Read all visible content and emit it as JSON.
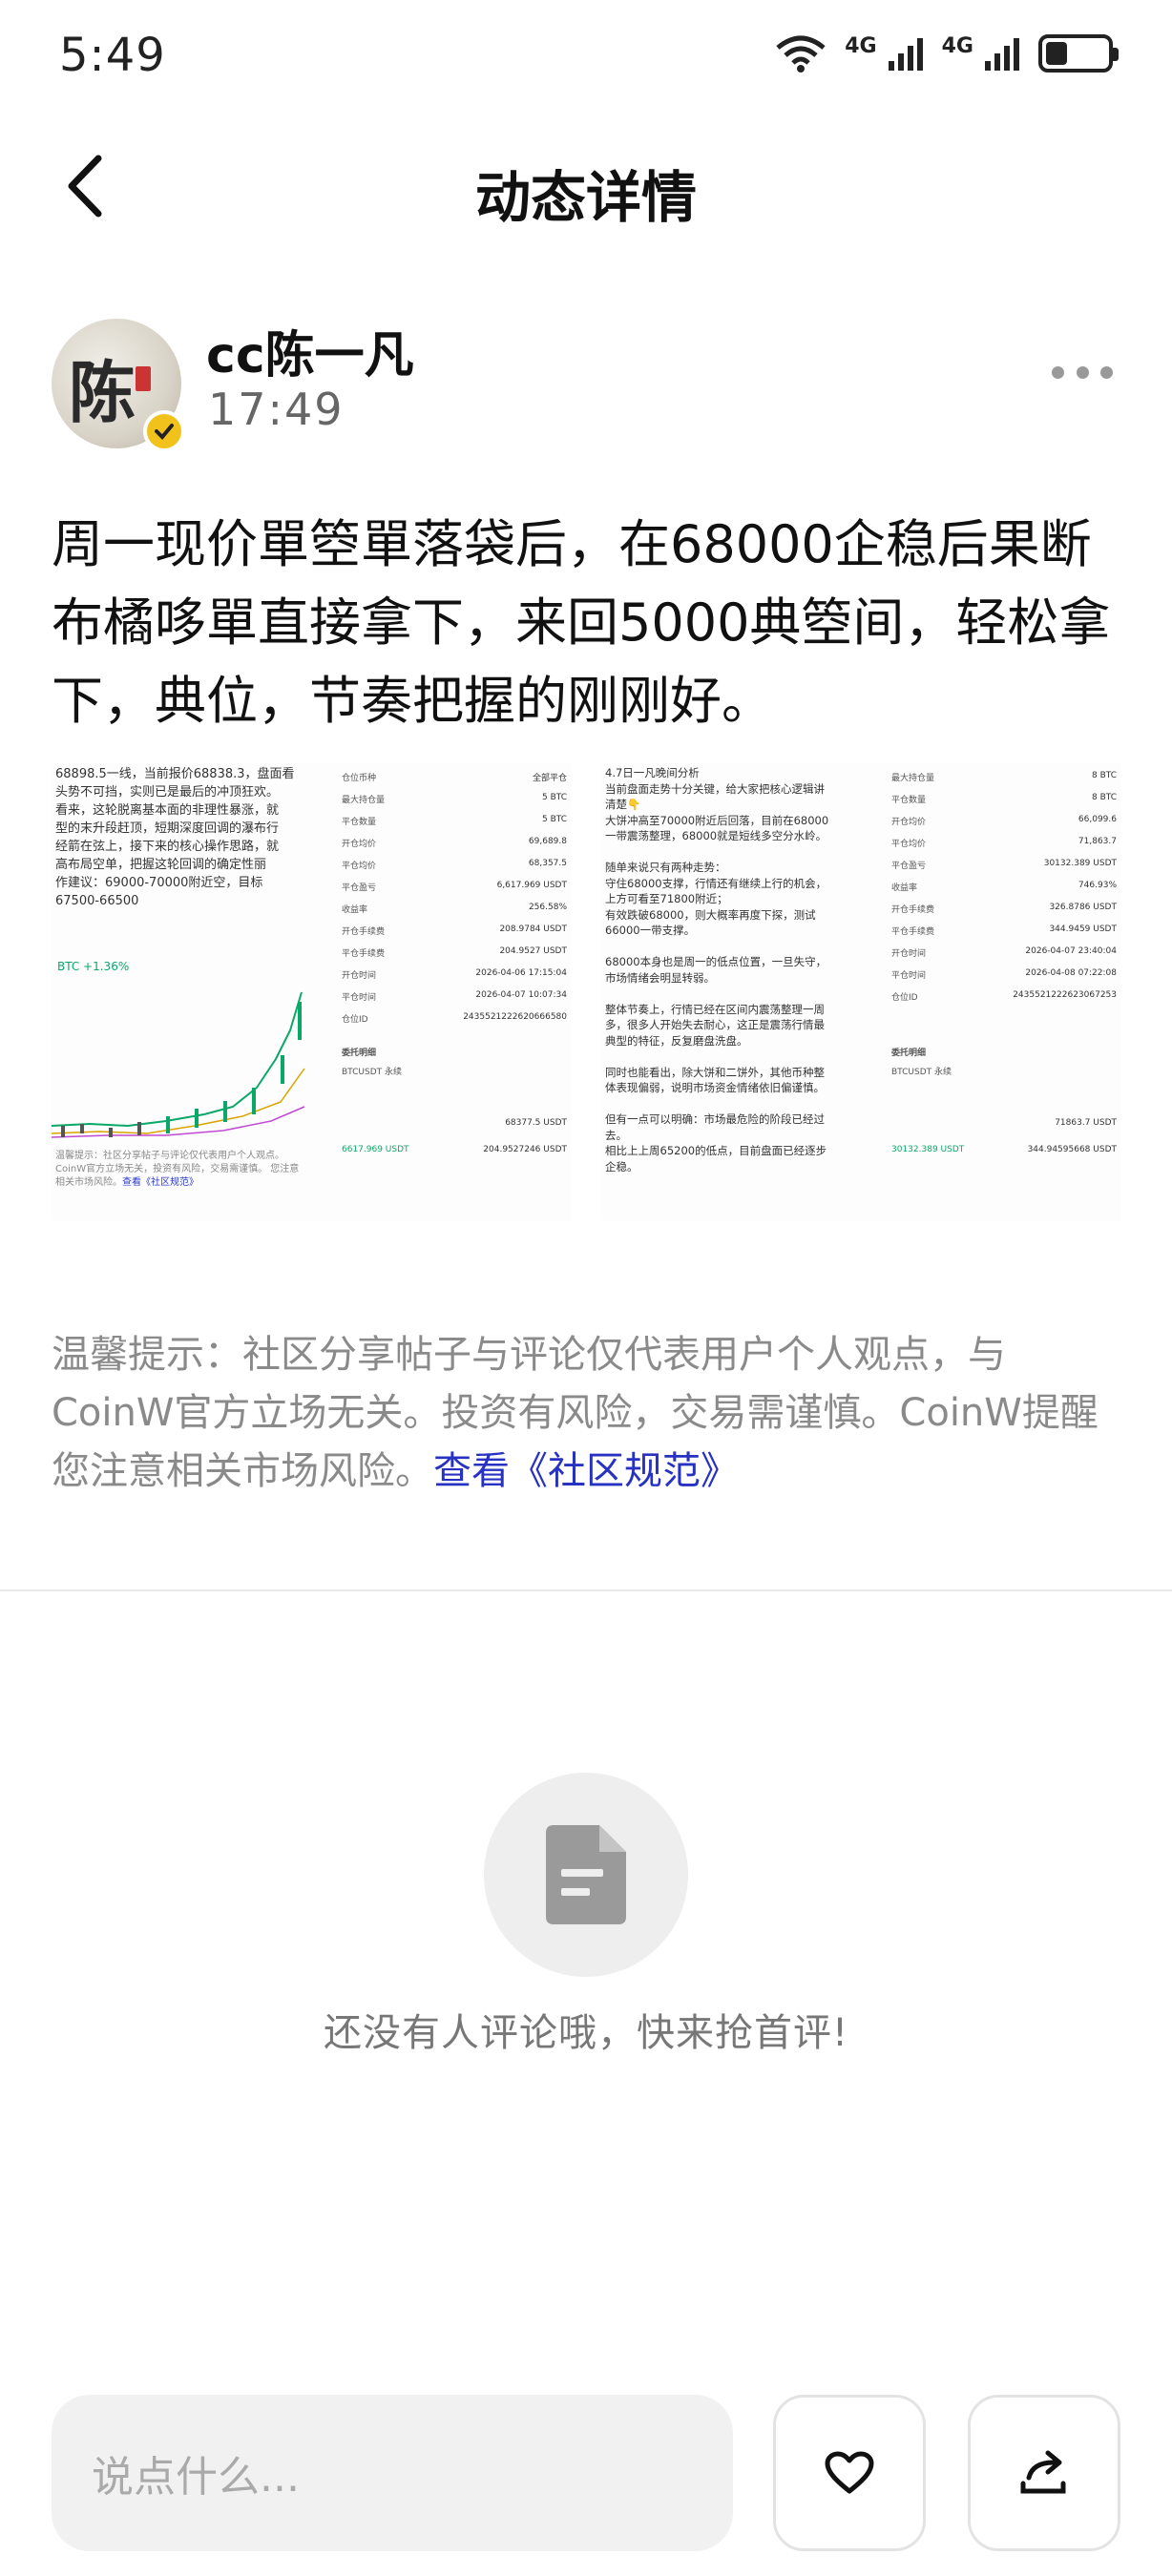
{
  "status_bar": {
    "time": "5:49",
    "network_1": "4G",
    "network_2": "4G",
    "battery_level": 0.35
  },
  "header": {
    "title": "动态详情"
  },
  "author": {
    "name": "cc陈一凡",
    "avatar_char": "陈",
    "time": "17:49"
  },
  "post": {
    "text": "周一现价單箜單落袋后，在68000企稳后果断布橘哆單直接拿下，来回5000典箜间，轻松拿下，典位，节奏把握的刚刚好。"
  },
  "images": [
    {
      "lines": "68898.5一线，当前报价68838.3，盘面看\n头势不可挡，实则已是最后的冲顶狂欢。\n看来，这轮脱离基本面的非理性暴涨，就\n型的末升段赶顶，短期深度回调的瀑布行\n经箭在弦上，接下来的核心操作思路，就\n高布局空单，把握这轮回调的确定性丽\n作建议：69000-70000附近空，目标\n67500-66500",
      "btc_tag": "BTC +1.36%",
      "disclaimer": "温馨提示：社区分享帖子与评论仅代表用户个人观点。\nCoinW官方立场无关，投资有风险，交易需谨慎。\n您注意相关市场风险。",
      "disclaimer_link": "查看《社区规范》",
      "rows": [
        [
          "仓位币种",
          "全部平仓"
        ],
        [
          "最大持仓量",
          "5 BTC"
        ],
        [
          "平仓数量",
          "5 BTC"
        ],
        [
          "开仓均价",
          "69,689.8"
        ],
        [
          "平仓均价",
          "68,357.5"
        ],
        [
          "平仓盈亏",
          "6,617.969 USDT"
        ],
        [
          "收益率",
          "256.58%"
        ],
        [
          "开仓手续费",
          "208.9784 USDT"
        ],
        [
          "平仓手续费",
          "204.9527 USDT"
        ],
        [
          "开仓时间",
          "2026-04-06 17:15:04"
        ],
        [
          "平仓时间",
          "2026-04-07 10:07:34"
        ],
        [
          "仓位ID",
          "2435521222620666580"
        ]
      ],
      "bottom_label": "委托明细",
      "bottom_sub": "BTCUSDT 永续",
      "bottom_vals": [
        "68377.5 USDT",
        "6617.969 USDT",
        "204.9527246 USDT"
      ]
    },
    {
      "lines": "4.7日一凡晚间分析\n当前盘面走势十分关键，给大家把核心逻辑讲\n清楚👇\n大饼冲高至70000附近后回落，目前在68000\n一带震荡整理，68000就是短线多空分水岭。\n\n随单来说只有两种走势：\n守住68000支撑，行情还有继续上行的机会，\n上方可看至71800附近；\n有效跌破68000，则大概率再度下探，测试\n66000一带支撑。\n\n68000本身也是周一的低点位置，一旦失守，\n市场情绪会明显转弱。\n\n整体节奏上，行情已经在区间内震荡整理一周\n多，很多人开始失去耐心，这正是震荡行情最\n典型的特征，反复磨盘洗盘。\n\n同时也能看出，除大饼和二饼外，其他币种整\n体表现偏弱，说明市场资金情绪依旧偏谨慎。\n\n但有一点可以明确：市场最危险的阶段已经过\n去。\n相比上上周65200的低点，目前盘面已经逐步\n企稳。",
      "rows": [
        [
          "最大持仓量",
          "8 BTC"
        ],
        [
          "平仓数量",
          "8 BTC"
        ],
        [
          "开仓均价",
          "66,099.6"
        ],
        [
          "平仓均价",
          "71,863.7"
        ],
        [
          "平仓盈亏",
          "30132.389 USDT"
        ],
        [
          "收益率",
          "746.93%"
        ],
        [
          "开仓手续费",
          "326.8786 USDT"
        ],
        [
          "平仓手续费",
          "344.9459 USDT"
        ],
        [
          "开仓时间",
          "2026-04-07 23:40:04"
        ],
        [
          "平仓时间",
          "2026-04-08 07:22:08"
        ],
        [
          "仓位ID",
          "2435521222623067253"
        ]
      ],
      "bottom_label": "委托明细",
      "bottom_sub": "BTCUSDT 永续",
      "bottom_vals": [
        "71863.7 USDT",
        "30132.389 USDT",
        "344.94595668 USDT"
      ]
    }
  ],
  "disclaimer": {
    "text": "温馨提示：社区分享帖子与评论仅代表用户个人观点，与CoinW官方立场无关。投资有风险，交易需谨慎。CoinW提醒您注意相关市场风险。",
    "link": "查看《社区规范》"
  },
  "comments": {
    "empty_text": "还没有人评论哦，快来抢首评!"
  },
  "bottom_bar": {
    "placeholder": "说点什么..."
  }
}
